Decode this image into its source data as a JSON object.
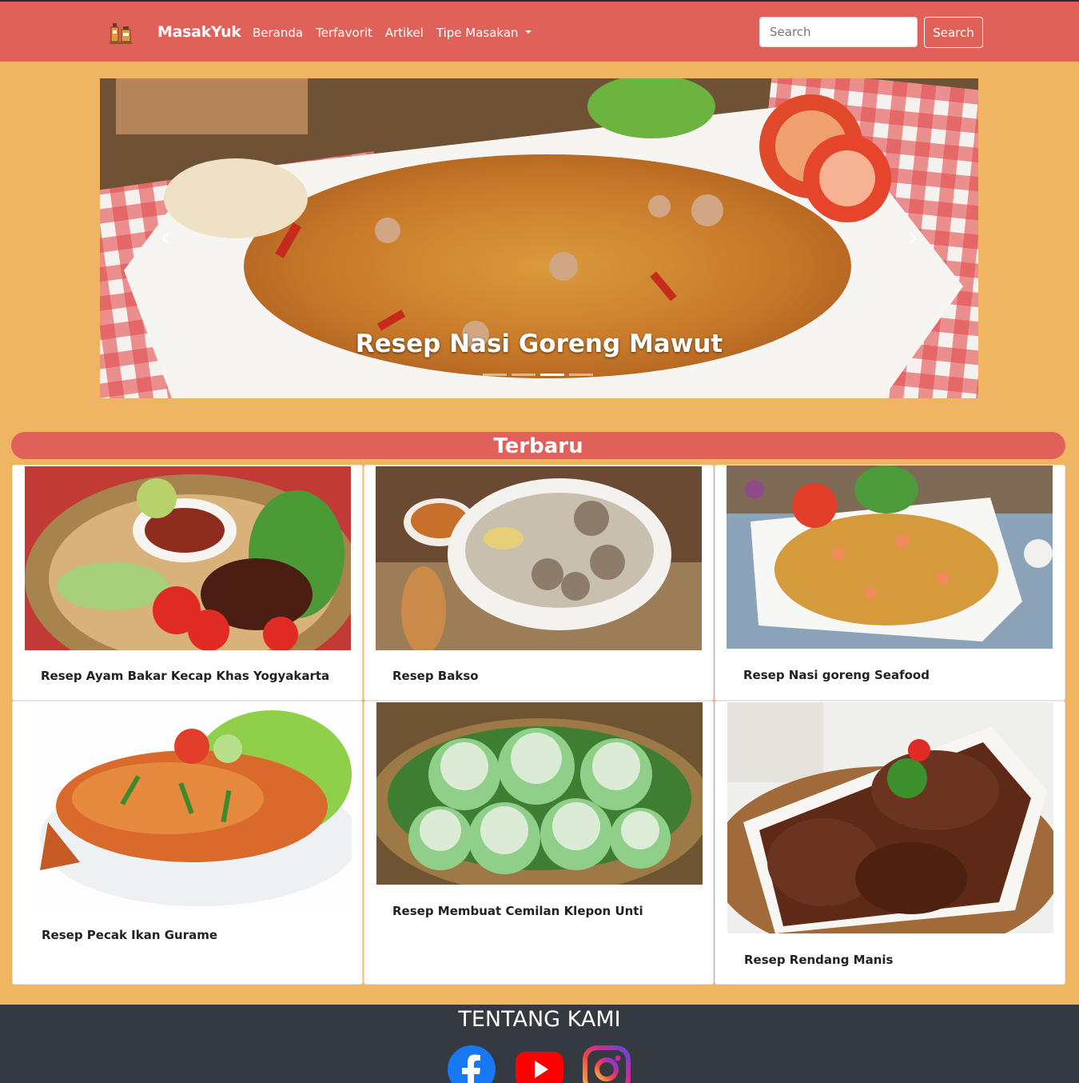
{
  "navbar": {
    "brand": "MasakYuk",
    "links": [
      "Beranda",
      "Terfavorit",
      "Artikel"
    ],
    "dropdown_label": "Tipe Masakan",
    "search_placeholder": "Search",
    "search_button": "Search"
  },
  "carousel": {
    "caption": "Resep Nasi Goreng Mawut",
    "indicator_count": 4,
    "active_index": 2
  },
  "section": {
    "title": "Terbaru"
  },
  "cards": [
    {
      "title": "Resep Ayam Bakar Kecap Khas Yogyakarta"
    },
    {
      "title": "Resep Bakso"
    },
    {
      "title": "Resep Nasi goreng Seafood"
    },
    {
      "title": "Resep Pecak Ikan Gurame"
    },
    {
      "title": "Resep Membuat Cemilan Klepon Unti"
    },
    {
      "title": "Resep Rendang Manis"
    }
  ],
  "footer": {
    "title": "TENTANG KAMI",
    "social_icons": [
      "facebook-icon",
      "youtube-icon",
      "instagram-icon"
    ]
  },
  "colors": {
    "accent": "#e0615a",
    "background": "#efb563",
    "footer": "#353a40"
  }
}
